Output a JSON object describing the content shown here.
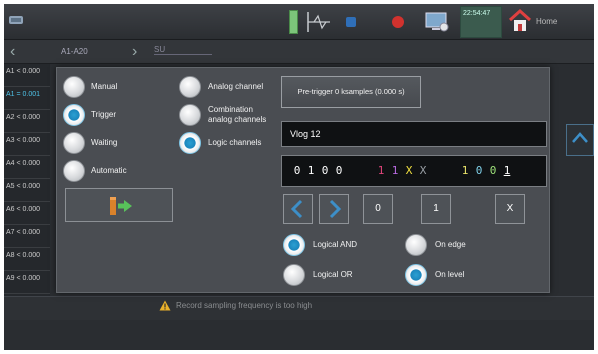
{
  "topbar": {
    "time": "22:54:47",
    "home_label": "Home"
  },
  "subbar": {
    "channel_range": "A1-A20",
    "su_label": "SU"
  },
  "channel_list": [
    {
      "label": "A1 < 0.000"
    },
    {
      "label": "A1 = 0.001"
    },
    {
      "label": "A2 < 0.000"
    },
    {
      "label": "A3 < 0.000"
    },
    {
      "label": "A4 < 0.000"
    },
    {
      "label": "A5 < 0.000"
    },
    {
      "label": "A6 < 0.000"
    },
    {
      "label": "A7 < 0.000"
    },
    {
      "label": "A8 < 0.000"
    },
    {
      "label": "A9 < 0.000"
    }
  ],
  "warning": {
    "text": "Record sampling frequency is too high"
  },
  "dialog": {
    "mode_options": [
      {
        "label": "Manual",
        "selected": false
      },
      {
        "label": "Trigger",
        "selected": true
      },
      {
        "label": "Waiting",
        "selected": false
      },
      {
        "label": "Automatic",
        "selected": false
      }
    ],
    "source_options": [
      {
        "label": "Analog channel",
        "selected": false
      },
      {
        "label": "Combination analog channels",
        "selected": false
      },
      {
        "label": "Logic channels",
        "selected": true
      }
    ],
    "pretrigger_label": "Pre-trigger 0 ksamples (0.000 s)",
    "name_value": "Vlog 12",
    "pattern_bits": [
      {
        "v": "0",
        "color": "#ffffff"
      },
      {
        "v": "1",
        "color": "#ffffff"
      },
      {
        "v": "0",
        "color": "#ffffff"
      },
      {
        "v": "0",
        "color": "#ffffff"
      },
      {
        "v": " ",
        "color": "#ffffff"
      },
      {
        "v": " ",
        "color": "#ffffff"
      },
      {
        "v": "1",
        "color": "#e0447a"
      },
      {
        "v": "1",
        "color": "#b86ae0"
      },
      {
        "v": "X",
        "color": "#f0e040"
      },
      {
        "v": "X",
        "color": "#9aa0a6"
      },
      {
        "v": " ",
        "color": "#ffffff"
      },
      {
        "v": " ",
        "color": "#ffffff"
      },
      {
        "v": "1",
        "color": "#e8e26a"
      },
      {
        "v": "0",
        "color": "#7fd0e8"
      },
      {
        "v": "0",
        "color": "#9ee27a"
      },
      {
        "v": "1",
        "color": "#ffffff"
      }
    ],
    "btn_zero": "0",
    "btn_one": "1",
    "btn_x": "X",
    "logic_options": [
      {
        "label": "Logical AND",
        "selected": true
      },
      {
        "label": "Logical OR",
        "selected": false
      }
    ],
    "edge_options": [
      {
        "label": "On edge",
        "selected": false
      },
      {
        "label": "On level",
        "selected": true
      }
    ]
  }
}
